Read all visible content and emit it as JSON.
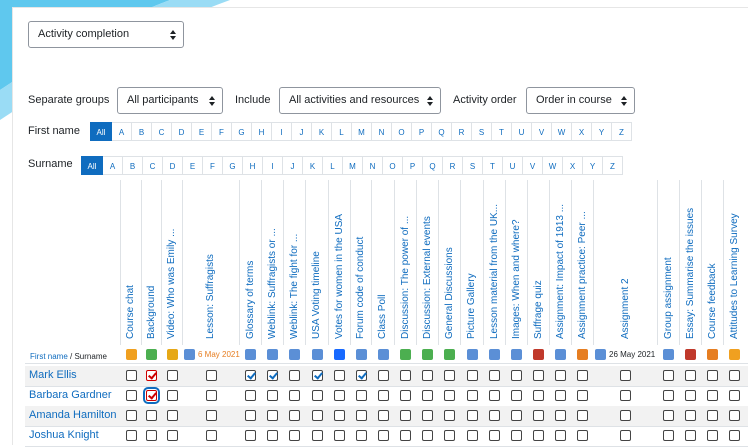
{
  "report_select": {
    "value": "Activity completion"
  },
  "filters": {
    "groups_label": "Separate groups",
    "groups_value": "All participants",
    "include_label": "Include",
    "include_value": "All activities and resources",
    "order_label": "Activity order",
    "order_value": "Order in course"
  },
  "initials": {
    "first_label": "First name",
    "surname_label": "Surname",
    "all_label": "All",
    "letters": [
      "A",
      "B",
      "C",
      "D",
      "E",
      "F",
      "G",
      "H",
      "I",
      "J",
      "K",
      "L",
      "M",
      "N",
      "O",
      "P",
      "Q",
      "R",
      "S",
      "T",
      "U",
      "V",
      "W",
      "X",
      "Y",
      "Z"
    ]
  },
  "table": {
    "name_header_first": "First name",
    "name_header_sep": " / ",
    "name_header_last": "Surname",
    "columns": [
      {
        "label": "Course chat",
        "icon": "chat-icon",
        "color": "#f0a020"
      },
      {
        "label": "Background",
        "icon": "book-icon",
        "color": "#4caf50"
      },
      {
        "label": "Video: Who was Emily ...",
        "icon": "url-icon",
        "color": "#e6a817"
      },
      {
        "label": "Lesson: Suffragists",
        "icon": "lesson-icon",
        "color": "#5b8fd6",
        "date": "6 May 2021"
      },
      {
        "label": "Glossary of terms",
        "icon": "glossary-icon",
        "color": "#5b8fd6"
      },
      {
        "label": "Weblink: Suffragists or ...",
        "icon": "url-icon",
        "color": "#5b8fd6"
      },
      {
        "label": "Weblink: The fight for ...",
        "icon": "url-icon",
        "color": "#5b8fd6"
      },
      {
        "label": "USA Voting timeline",
        "icon": "file-icon",
        "color": "#5b8fd6"
      },
      {
        "label": "Votes for women in the USA",
        "icon": "h5p-icon",
        "color": "#1769ff"
      },
      {
        "label": "Forum code of conduct",
        "icon": "page-icon",
        "color": "#5b8fd6"
      },
      {
        "label": "Class Poll",
        "icon": "poll-icon",
        "color": "#5b8fd6"
      },
      {
        "label": "Discussion: The power of ...",
        "icon": "forum-icon",
        "color": "#4caf50"
      },
      {
        "label": "Discussion: External events",
        "icon": "forum-icon",
        "color": "#4caf50"
      },
      {
        "label": "General Discussions",
        "icon": "forum-icon",
        "color": "#4caf50"
      },
      {
        "label": "Picture Gallery",
        "icon": "database-icon",
        "color": "#5b8fd6"
      },
      {
        "label": "Lesson material from the UK...",
        "icon": "file-icon",
        "color": "#5b8fd6"
      },
      {
        "label": "Images: When and where?",
        "icon": "folder-icon",
        "color": "#5b8fd6"
      },
      {
        "label": "Suffrage quiz",
        "icon": "quiz-icon",
        "color": "#c0392b"
      },
      {
        "label": "Assignment: Impact of 1913 ...",
        "icon": "assignment-icon",
        "color": "#5b8fd6"
      },
      {
        "label": "Assignment practice: Peer ...",
        "icon": "workshop-icon",
        "color": "#e67e22"
      },
      {
        "label": "Assignment 2",
        "icon": "assignment-icon",
        "color": "#5b8fd6",
        "date": "26 May 2021"
      },
      {
        "label": "Group assignment",
        "icon": "assignment-icon",
        "color": "#5b8fd6"
      },
      {
        "label": "Essay: Summarise the issues",
        "icon": "quiz-icon",
        "color": "#c0392b"
      },
      {
        "label": "Course feedback",
        "icon": "feedback-icon",
        "color": "#e67e22"
      },
      {
        "label": "Attitudes to Learning Survey",
        "icon": "survey-icon",
        "color": "#f0a020"
      }
    ],
    "rows": [
      {
        "name": "Mark Ellis",
        "checks": [
          0,
          2,
          0,
          0,
          1,
          1,
          0,
          1,
          0,
          1,
          0,
          0,
          0,
          0,
          0,
          0,
          0,
          0,
          0,
          0,
          0,
          0,
          0,
          0,
          0
        ]
      },
      {
        "name": "Barbara Gardner",
        "checks": [
          0,
          3,
          0,
          0,
          0,
          0,
          0,
          0,
          0,
          0,
          0,
          0,
          0,
          0,
          0,
          0,
          0,
          0,
          0,
          0,
          0,
          0,
          0,
          0,
          0
        ]
      },
      {
        "name": "Amanda Hamilton",
        "checks": [
          0,
          0,
          0,
          0,
          0,
          0,
          0,
          0,
          0,
          0,
          0,
          0,
          0,
          0,
          0,
          0,
          0,
          0,
          0,
          0,
          0,
          0,
          0,
          0,
          0
        ]
      },
      {
        "name": "Joshua Knight",
        "checks": [
          0,
          0,
          0,
          0,
          0,
          0,
          0,
          0,
          0,
          0,
          0,
          0,
          0,
          0,
          0,
          0,
          0,
          0,
          0,
          0,
          0,
          0,
          0,
          0,
          0
        ]
      }
    ]
  }
}
